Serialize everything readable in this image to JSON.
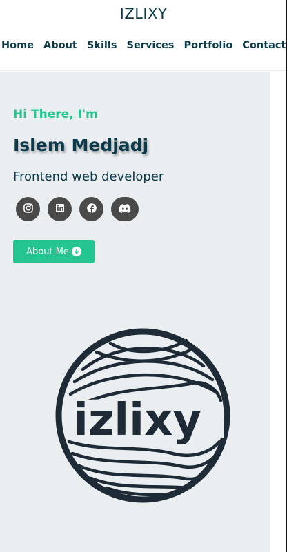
{
  "header": {
    "brand": "IZLIXY",
    "nav": [
      "Home",
      "About",
      "Skills",
      "Services",
      "Portfolio",
      "Contact"
    ]
  },
  "hero": {
    "greeting": "Hi There, I'm",
    "name": "Islem Medjadj",
    "role": "Frontend web developer",
    "socials": [
      "instagram-icon",
      "linkedin-icon",
      "facebook-icon",
      "discord-icon"
    ],
    "button_label": "About Me",
    "logo_text": "izlixy"
  },
  "colors": {
    "accent": "#24c590",
    "primary_text": "#0b3a4a",
    "hero_bg": "#ebeef1",
    "social_bg": "#4a4a4a",
    "logo": "#1e2a35"
  }
}
